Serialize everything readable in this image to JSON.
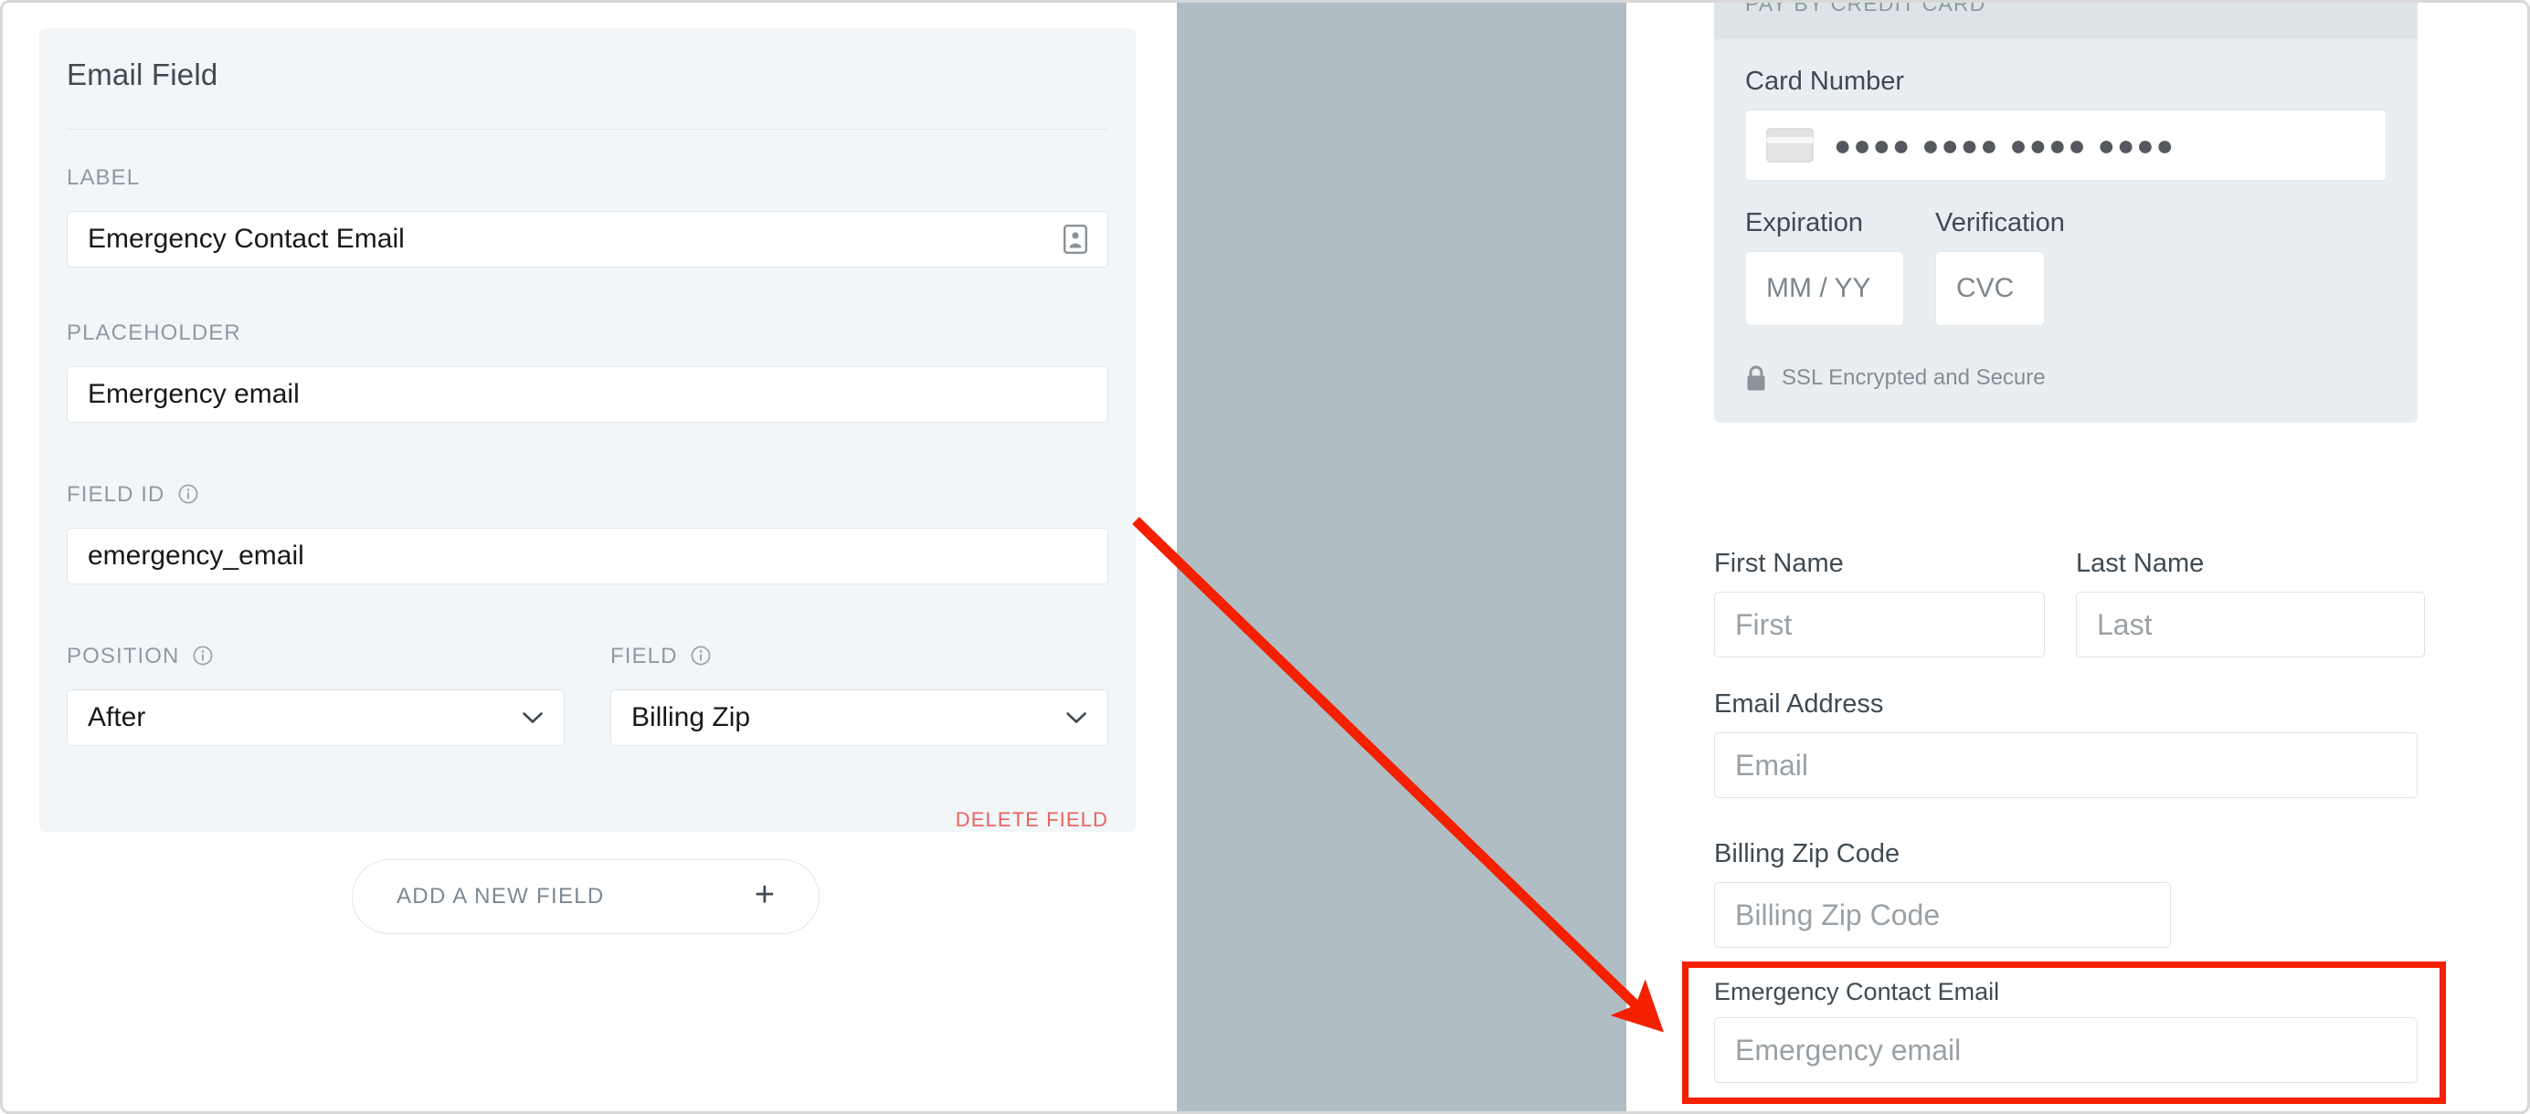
{
  "editor": {
    "title": "Email Field",
    "label_field": {
      "label": "LABEL",
      "value": "Emergency Contact Email",
      "icon": "id-badge-icon"
    },
    "placeholder_field": {
      "label": "PLACEHOLDER",
      "value": "Emergency email"
    },
    "field_id_field": {
      "label": "FIELD ID",
      "value": "emergency_email",
      "info_icon": "info-circle-icon"
    },
    "position_field": {
      "label": "POSITION",
      "value": "After",
      "info_icon": "info-circle-icon",
      "chevron_icon": "chevron-down-icon"
    },
    "field_select": {
      "label": "FIELD",
      "value": "Billing Zip",
      "info_icon": "info-circle-icon",
      "chevron_icon": "chevron-down-icon"
    },
    "delete_label": "DELETE FIELD",
    "delete_color": "#e8645f",
    "add_field_label": "ADD A NEW FIELD",
    "add_field_icon": "plus-icon"
  },
  "preview": {
    "credit_card": {
      "header": "PAY BY CREDIT CARD",
      "card_number_label": "Card Number",
      "card_number_value": "●●●● ●●●● ●●●● ●●●●",
      "card_icon": "credit-card-icon",
      "expiration_label": "Expiration",
      "expiration_placeholder": "MM / YY",
      "verification_label": "Verification",
      "verification_placeholder": "CVC",
      "ssl_text": "SSL Encrypted and Secure",
      "ssl_icon": "lock-icon"
    },
    "first_name": {
      "label": "First Name",
      "placeholder": "First"
    },
    "last_name": {
      "label": "Last Name",
      "placeholder": "Last"
    },
    "email": {
      "label": "Email Address",
      "placeholder": "Email"
    },
    "billing_zip": {
      "label": "Billing Zip Code",
      "placeholder": "Billing Zip Code"
    },
    "emergency": {
      "label": "Emergency Contact Email",
      "placeholder": "Emergency email",
      "highlight_color": "#f42000"
    }
  },
  "annotation": {
    "arrow_color": "#f42000"
  }
}
